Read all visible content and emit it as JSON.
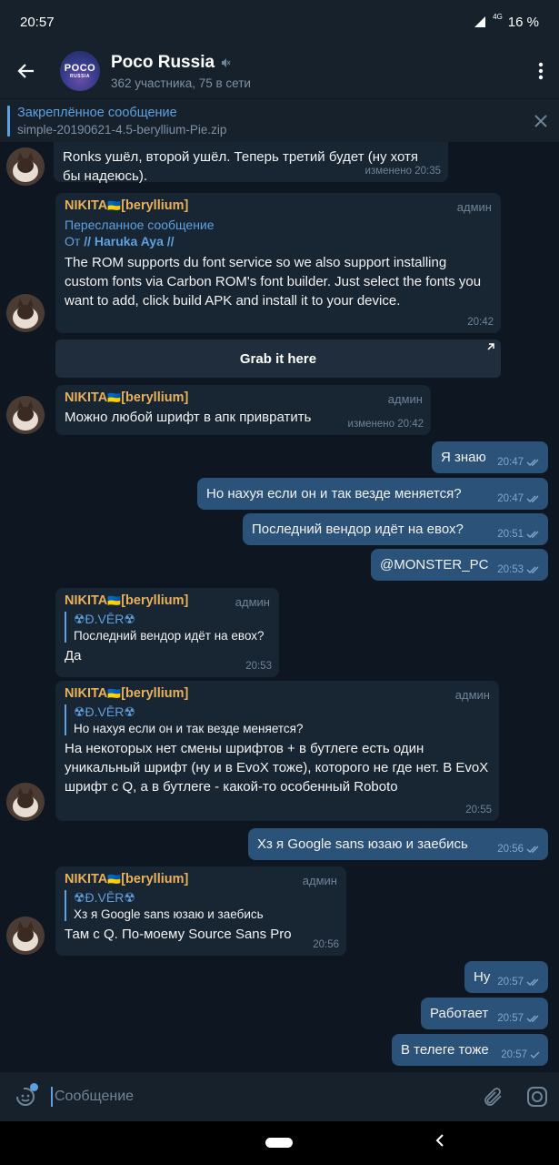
{
  "status": {
    "time": "20:57",
    "network": "4G",
    "battery": "16 %"
  },
  "header": {
    "title": "Poco Russia",
    "subtitle": "362 участника, 75 в сети",
    "avatar_logo": "POCO",
    "avatar_sub": "RUSSIA"
  },
  "pinned": {
    "title": "Закреплённое сообщение",
    "text": "simple-20190621-4.5-beryllium-Pie.zip"
  },
  "messages": {
    "m1": {
      "text": "Ronks ушёл, второй ушёл. Теперь третий будет (ну хотя бы надеюсь).",
      "time": "изменено 20:35"
    },
    "m2": {
      "sender": "NIKITA",
      "flag": "🇺🇦",
      "sender_tag": "[beryllium]",
      "role": "админ",
      "fwd_label": "Пересланное сообщение",
      "fwd_from_prefix": "От",
      "fwd_from": "// Haruka Aya //",
      "text": "The ROM supports du font service so we also support installing custom fonts via Carbon ROM's font builder. Just select the fonts you want to add, click build APK and install it to your device.",
      "time": "20:42",
      "button": "Grab it here"
    },
    "m3": {
      "sender": "NIKITA",
      "flag": "🇺🇦",
      "sender_tag": "[beryllium]",
      "role": "админ",
      "text": "Можно любой шрифт в апк привратить",
      "time": "изменено 20:42"
    },
    "o1": {
      "text": "Я знаю",
      "time": "20:47"
    },
    "o2": {
      "text": "Но нахуя если он и так везде меняется?",
      "time": "20:47"
    },
    "o3": {
      "text": "Последний вендор идёт на евох?",
      "time": "20:51"
    },
    "o4": {
      "text": "@MONSTER_PC",
      "time": "20:53"
    },
    "m4": {
      "sender": "NIKITA",
      "flag": "🇺🇦",
      "sender_tag": "[beryllium]",
      "role": "админ",
      "reply_name": "☢Đ.VĒR☢",
      "reply_text": "Последний вендор идёт на евох?",
      "text": "Да",
      "time": "20:53"
    },
    "m5": {
      "sender": "NIKITA",
      "flag": "🇺🇦",
      "sender_tag": "[beryllium]",
      "role": "админ",
      "reply_name": "☢Đ.VĒR☢",
      "reply_text": "Но нахуя если он и так везде меняется?",
      "text": "На некоторых нет смены шрифтов + в бутлеге есть один уникальный шрифт (ну и в EvoX тоже), которого не где нет. В EvoX шрифт с Q, а в бутлеге - какой-то особенный Roboto",
      "time": "20:55"
    },
    "o5": {
      "text": "Хз я Google sans юзаю и заебись",
      "time": "20:56"
    },
    "m6": {
      "sender": "NIKITA",
      "flag": "🇺🇦",
      "sender_tag": "[beryllium]",
      "role": "админ",
      "reply_name": "☢Đ.VĒR☢",
      "reply_text": "Хз я Google sans юзаю и заебись",
      "text": "Там с Q. По-моему Source Sans Pro",
      "time": "20:56"
    },
    "o6": {
      "text": "Ну",
      "time": "20:57"
    },
    "o7": {
      "text": "Работает",
      "time": "20:57"
    },
    "o8": {
      "text": "В телеге тоже",
      "time": "20:57"
    }
  },
  "input": {
    "placeholder": "Сообщение"
  },
  "colors": {
    "accent": "#5ea1df",
    "sender": "#e9b15a",
    "bubble_out": "#2b5278",
    "bubble_in": "#182533",
    "background": "#0e1621"
  }
}
